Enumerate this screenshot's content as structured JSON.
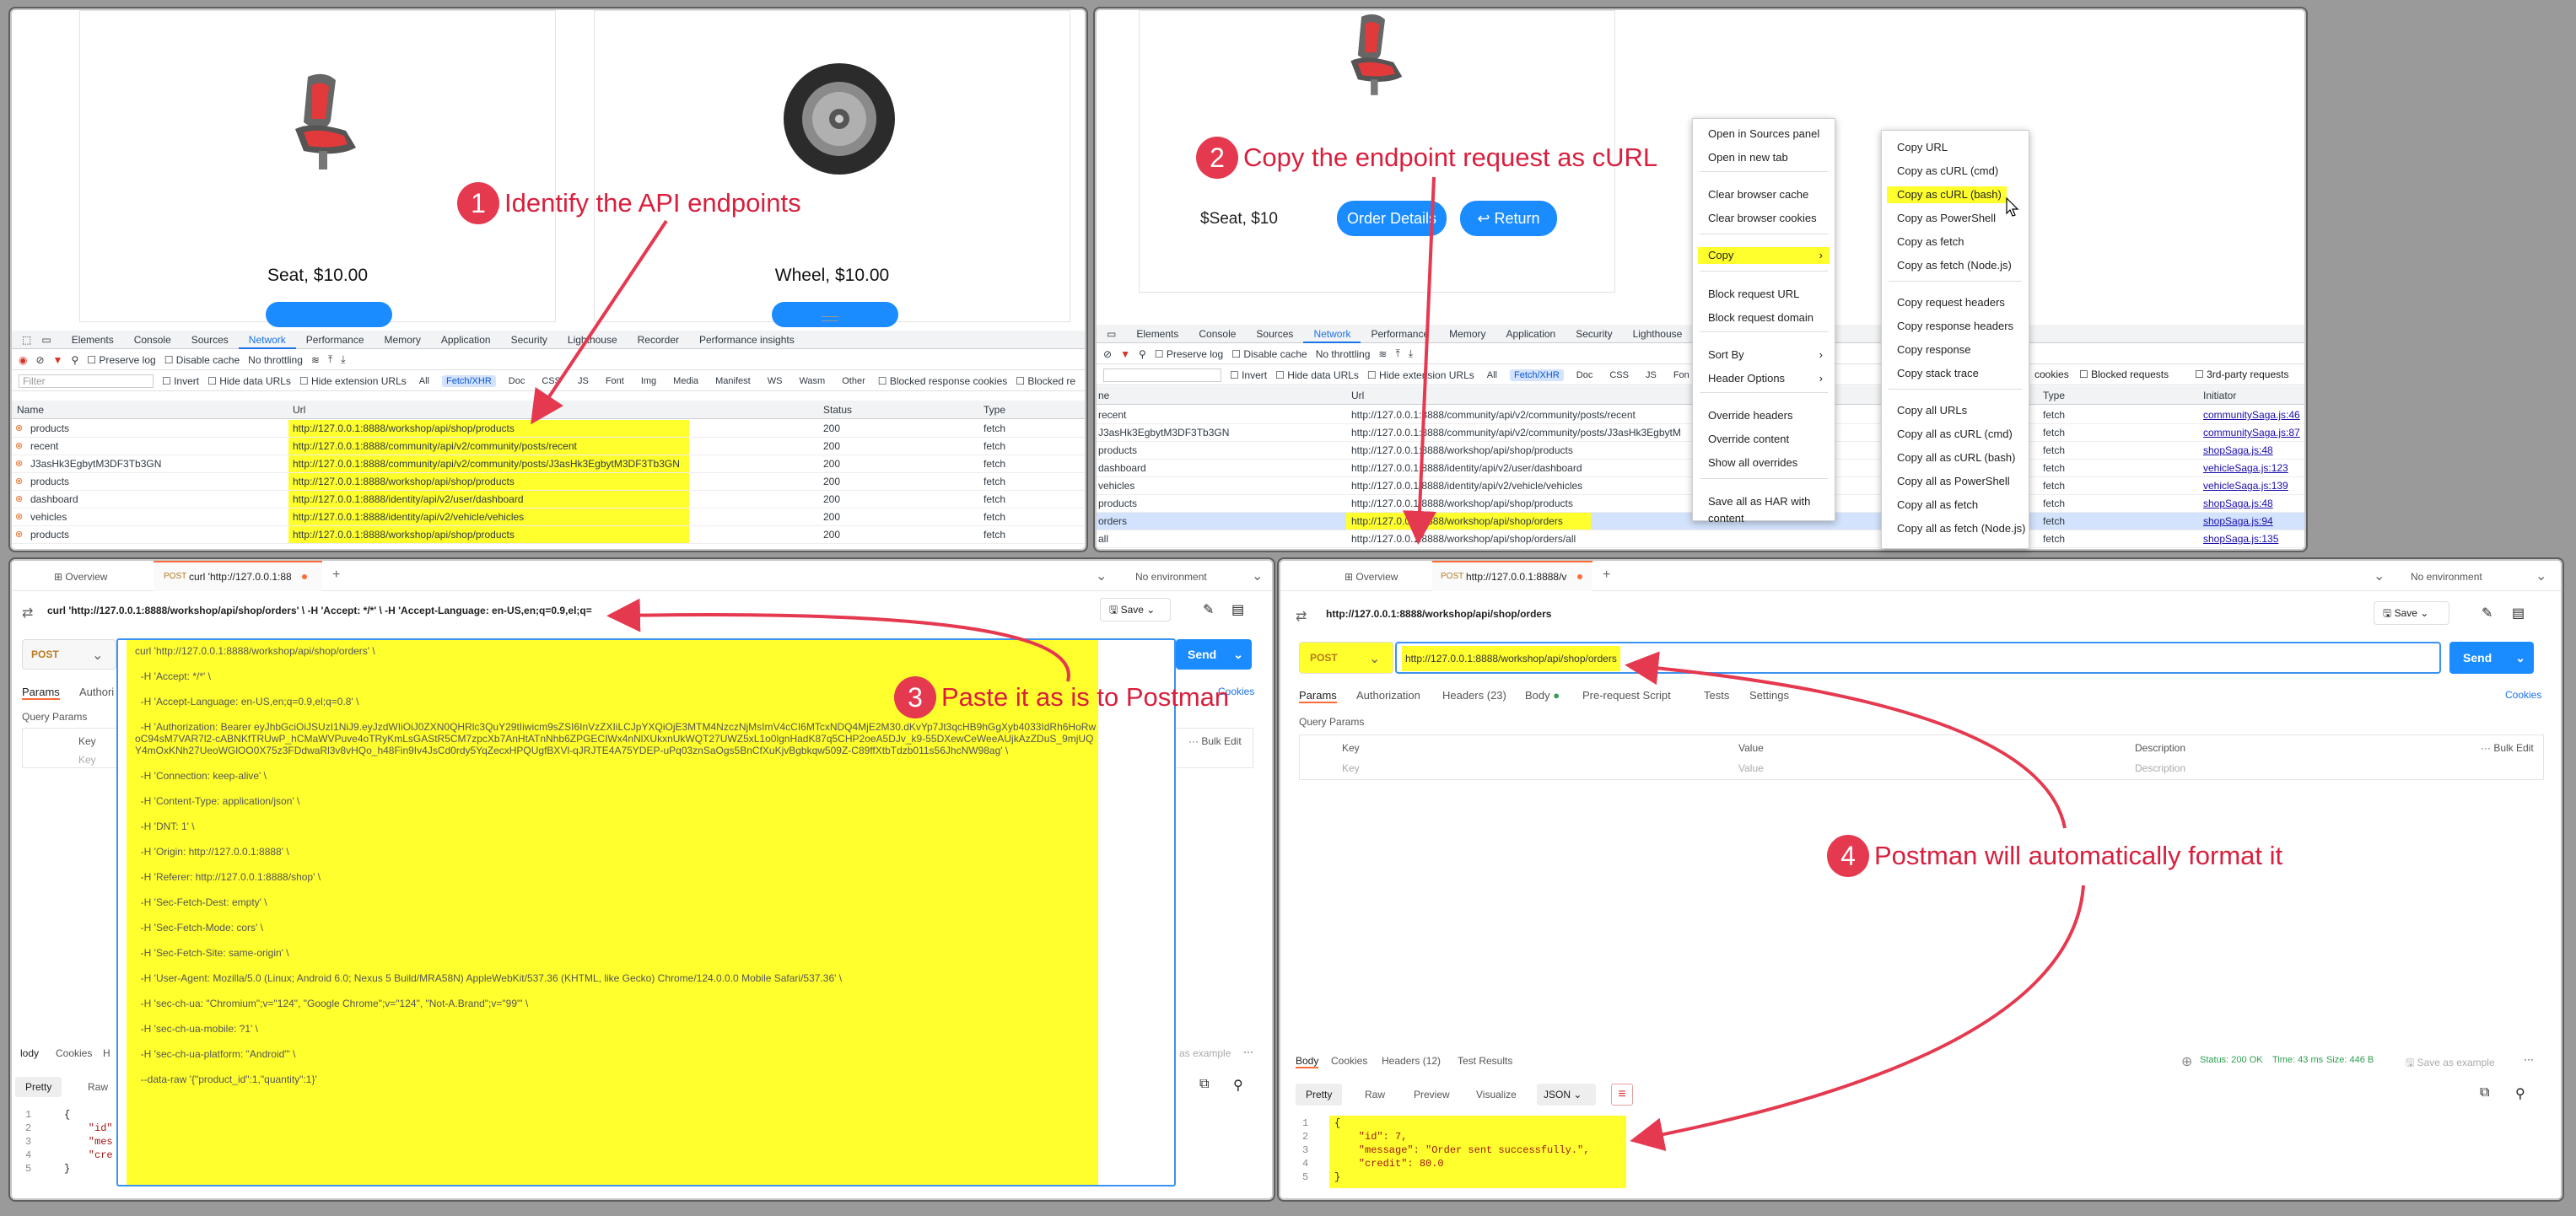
{
  "p1": {
    "products": [
      {
        "name": "Seat, $10.00"
      },
      {
        "name": "Wheel, $10.00"
      }
    ],
    "tabs": [
      "Elements",
      "Console",
      "Sources",
      "Network",
      "Performance",
      "Memory",
      "Application",
      "Security",
      "Lighthouse",
      "Recorder",
      "Performance insights"
    ],
    "toolbar": {
      "preserve": "Preserve log",
      "disable": "Disable cache",
      "throttle": "No throttling"
    },
    "filter": {
      "placeholder": "Filter",
      "invert": "Invert",
      "hide_data": "Hide data URLs",
      "hide_ext": "Hide extension URLs",
      "chips": [
        "All",
        "Fetch/XHR",
        "Doc",
        "CSS",
        "JS",
        "Font",
        "Img",
        "Media",
        "Manifest",
        "WS",
        "Wasm",
        "Other"
      ],
      "blocked": "Blocked response cookies",
      "blocked2": "Blocked re"
    },
    "cols": {
      "name": "Name",
      "url": "Url",
      "status": "Status",
      "type": "Type"
    },
    "rows": [
      {
        "name": "products",
        "url": "http://127.0.0.1:8888/workshop/api/shop/products",
        "status": "200",
        "type": "fetch"
      },
      {
        "name": "recent",
        "url": "http://127.0.0.1:8888/community/api/v2/community/posts/recent",
        "status": "200",
        "type": "fetch"
      },
      {
        "name": "J3asHk3EgbytM3DF3Tb3GN",
        "url": "http://127.0.0.1:8888/community/api/v2/community/posts/J3asHk3EgbytM3DF3Tb3GN",
        "status": "200",
        "type": "fetch"
      },
      {
        "name": "products",
        "url": "http://127.0.0.1:8888/workshop/api/shop/products",
        "status": "200",
        "type": "fetch"
      },
      {
        "name": "dashboard",
        "url": "http://127.0.0.1:8888/identity/api/v2/user/dashboard",
        "status": "200",
        "type": "fetch"
      },
      {
        "name": "vehicles",
        "url": "http://127.0.0.1:8888/identity/api/v2/vehicle/vehicles",
        "status": "200",
        "type": "fetch"
      },
      {
        "name": "products",
        "url": "http://127.0.0.1:8888/workshop/api/shop/products",
        "status": "200",
        "type": "fetch"
      }
    ],
    "callout": "Identify the API endpoints",
    "callout_num": "1"
  },
  "p2": {
    "item": "$Seat, $10",
    "order_btn": "Order Details",
    "return_btn": "Return",
    "return_icon": "↩",
    "tabs": [
      "Elements",
      "Console",
      "Sources",
      "Network",
      "Performance",
      "Memory",
      "Application",
      "Security",
      "Lighthouse"
    ],
    "toolbar": {
      "preserve": "Preserve log",
      "disable": "Disable cache",
      "throttle": "No throttling"
    },
    "filter": {
      "invert": "Invert",
      "hide_data": "Hide data URLs",
      "hide_ext": "Hide extension URLs",
      "chips": [
        "All",
        "Fetch/XHR",
        "Doc",
        "CSS",
        "JS",
        "Fon"
      ],
      "cookies": "cookies",
      "blocked": "Blocked requests",
      "third": "3rd-party requests"
    },
    "cols": {
      "name": "ne",
      "url": "Url",
      "type": "Type",
      "initiator": "Initiator"
    },
    "rows": [
      {
        "name": "recent",
        "url": "http://127.0.0.1:8888/community/api/v2/community/posts/recent",
        "type": "fetch",
        "init": "communitySaga.js:46"
      },
      {
        "name": "J3asHk3EgbytM3DF3Tb3GN",
        "url": "http://127.0.0.1:8888/community/api/v2/community/posts/J3asHk3EgbytM",
        "type": "fetch",
        "init": "communitySaga.js:87"
      },
      {
        "name": "products",
        "url": "http://127.0.0.1:8888/workshop/api/shop/products",
        "type": "fetch",
        "init": "shopSaga.js:48"
      },
      {
        "name": "dashboard",
        "url": "http://127.0.0.1:8888/identity/api/v2/user/dashboard",
        "type": "fetch",
        "init": "vehicleSaga.js:123"
      },
      {
        "name": "vehicles",
        "url": "http://127.0.0.1:8888/identity/api/v2/vehicle/vehicles",
        "type": "fetch",
        "init": "vehicleSaga.js:139"
      },
      {
        "name": "products",
        "url": "http://127.0.0.1:8888/workshop/api/shop/products",
        "type": "fetch",
        "init": "shopSaga.js:48"
      },
      {
        "name": "orders",
        "url": "http://127.0.0.1:8888/workshop/api/shop/orders",
        "type": "fetch",
        "init": "shopSaga.js:94"
      },
      {
        "name": "all",
        "url": "http://127.0.0.1:8888/workshop/api/shop/orders/all",
        "type": "fetch",
        "init": "shopSaga.js:135"
      }
    ],
    "menu1": [
      "Open in Sources panel",
      "Open in new tab",
      "Clear browser cache",
      "Clear browser cookies",
      "Copy",
      "Block request URL",
      "Block request domain",
      "Sort By",
      "Header Options",
      "Override headers",
      "Override content",
      "Show all overrides",
      "Save all as HAR with content"
    ],
    "menu2": [
      "Copy URL",
      "Copy as cURL (cmd)",
      "Copy as cURL (bash)",
      "Copy as PowerShell",
      "Copy as fetch",
      "Copy as fetch (Node.js)",
      "Copy request headers",
      "Copy response headers",
      "Copy response",
      "Copy stack trace",
      "Copy all URLs",
      "Copy all as cURL (cmd)",
      "Copy all as cURL (bash)",
      "Copy all as PowerShell",
      "Copy all as fetch",
      "Copy all as fetch (Node.js)"
    ],
    "callout": "Copy the endpoint request as cURL",
    "callout_num": "2"
  },
  "p3": {
    "overview": "Overview",
    "tab_method": "POST",
    "tab_title": "curl 'http://127.0.0.1:88",
    "env": "No environment",
    "title": "curl 'http://127.0.0.1:8888/workshop/api/shop/orders' \\ -H 'Accept: */*' \\ -H 'Accept-Language: en-US,en;q=0.9,el;q=",
    "save": "Save",
    "method": "POST",
    "send": "Send",
    "subtabs": [
      "Params",
      "Authori"
    ],
    "cookies": "Cookies",
    "query_params": "Query Params",
    "key": "Key",
    "key_ph": "Key",
    "bulk": "Bulk Edit",
    "resp_tabs": [
      "lody",
      "Cookies",
      "H"
    ],
    "save_example": "ve as example",
    "pretty": "Pretty",
    "raw": "Raw",
    "code_nums": [
      "1",
      "2",
      "3",
      "4",
      "5"
    ],
    "code": [
      "{",
      "    \"id\"",
      "    \"mes",
      "    \"cre",
      "}"
    ],
    "paste": [
      "curl 'http://127.0.0.1:8888/workshop/api/shop/orders' \\",
      "  -H 'Accept: */*' \\",
      "  -H 'Accept-Language: en-US,en;q=0.9,el;q=0.8' \\",
      "  -H 'Authorization: Bearer eyJhbGciOiJSUzI1NiJ9.eyJzdWIiOiJ0ZXN0QHRlc3QuY29tIiwicm9sZSI6InVzZXIiLCJpYXQiOjE3MTM4NzczNjMsImV4cCI6MTcxNDQ4MjE2M30.dKvYp7Jt3qcHB9hGgXyb4033IdRh6HoRwoC94sM7VAR7l2-cABNKfTRUwP_hCMaWVPuve4oTRyKmLsGAStR5CM7zpcXb7AnHtATnNhb6ZPGECIWx4nNlXUkxnUkWQT27UWZ5xL1o0lgnHadK87q5CHP2oeA5DJv_k9-55DXewCeWeeAUjkAzZDuS_9mjUQY4mOxKNh27UeoWGlOO0X75z3FDdwaRl3v8vHQo_h48Fin9Iv4JsCd0rdy5YqZecxHPQUgfBXVl-qJRJTE4A75YDEP-uPq03znSaOgs5BnCfXuKjvBgbkqw509Z-C89ffXtbTdzb011s56JhcNW98ag' \\",
      "  -H 'Connection: keep-alive' \\",
      "  -H 'Content-Type: application/json' \\",
      "  -H 'DNT: 1' \\",
      "  -H 'Origin: http://127.0.0.1:8888' \\",
      "  -H 'Referer: http://127.0.0.1:8888/shop' \\",
      "  -H 'Sec-Fetch-Dest: empty' \\",
      "  -H 'Sec-Fetch-Mode: cors' \\",
      "  -H 'Sec-Fetch-Site: same-origin' \\",
      "  -H 'User-Agent: Mozilla/5.0 (Linux; Android 6.0; Nexus 5 Build/MRA58N) AppleWebKit/537.36 (KHTML, like Gecko) Chrome/124.0.0.0 Mobile Safari/537.36' \\",
      "  -H 'sec-ch-ua: \"Chromium\";v=\"124\", \"Google Chrome\";v=\"124\", \"Not-A.Brand\";v=\"99\"' \\",
      "  -H 'sec-ch-ua-mobile: ?1' \\",
      "  -H 'sec-ch-ua-platform: \"Android\"' \\",
      "  --data-raw '{\"product_id\":1,\"quantity\":1}'"
    ],
    "callout": "Paste it as is to Postman",
    "callout_num": "3"
  },
  "p4": {
    "overview": "Overview",
    "tab_method": "POST",
    "tab_title": "http://127.0.0.1:8888/v",
    "env": "No environment",
    "title": "http://127.0.0.1:8888/workshop/api/shop/orders",
    "save": "Save",
    "method": "POST",
    "url": "http://127.0.0.1:8888/workshop/api/shop/orders",
    "send": "Send",
    "subtabs": [
      "Params",
      "Authorization",
      "Headers (23)",
      "Body",
      "Pre-request Script",
      "Tests",
      "Settings"
    ],
    "cookies": "Cookies",
    "query_params": "Query Params",
    "cols": [
      "Key",
      "Value",
      "Description"
    ],
    "ph": [
      "Key",
      "Value",
      "Description"
    ],
    "bulk": "Bulk Edit",
    "resp_tabs": [
      "Body",
      "Cookies",
      "Headers (12)",
      "Test Results"
    ],
    "status": "Status: 200 OK",
    "time": "Time: 43 ms",
    "size": "Size: 446 B",
    "save_example": "Save as example",
    "view": [
      "Pretty",
      "Raw",
      "Preview",
      "Visualize"
    ],
    "format": "JSON",
    "code_nums": [
      "1",
      "2",
      "3",
      "4",
      "5"
    ],
    "code": [
      "{",
      "    \"id\": 7,",
      "    \"message\": \"Order sent successfully.\",",
      "    \"credit\": 80.0",
      "}"
    ],
    "callout": "Postman will automatically format it",
    "callout_num": "4"
  },
  "colors": {
    "highlight": "#ffff2e",
    "callout": "#e53950",
    "blue": "#1a8cff",
    "postman_orange": "#ff6c37"
  }
}
